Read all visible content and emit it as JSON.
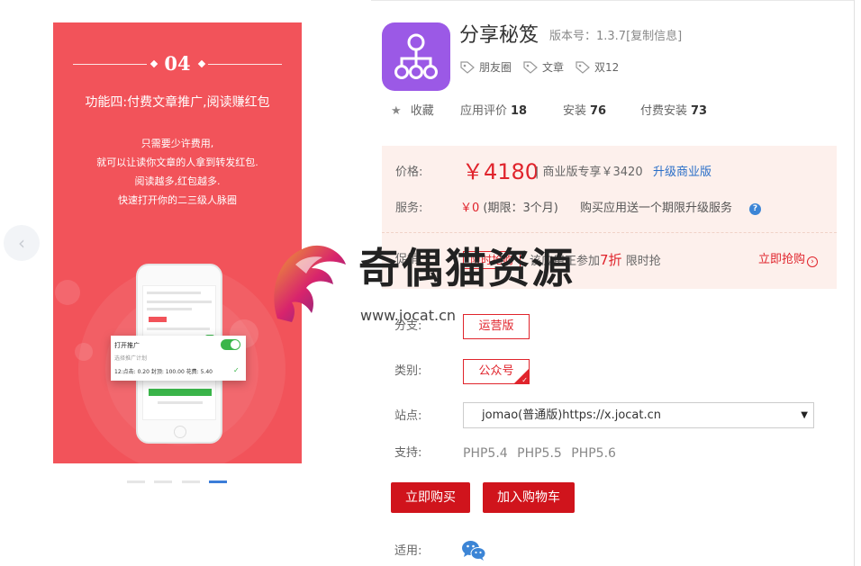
{
  "gallery": {
    "prev_icon": "chevron-left-icon",
    "slide": {
      "number": "04",
      "feature_title": "功能四:付费文章推广,阅读赚红包",
      "description_lines": [
        "只需要少许费用,",
        "就可以让读你文章的人拿到转发红包.",
        "阅读越多,红包越多.",
        "快速打开你的二三级人脉圈"
      ],
      "popup": {
        "title": "打开推广",
        "subtitle": "选择推广计划",
        "detail": "12:点击: 0.20 封顶: 100.00 花费: 5.40"
      }
    },
    "dots_active_index": 3
  },
  "app": {
    "icon_color": "#9b59e6",
    "name": "分享秘笈",
    "version_text": "版本号：1.3.7[复制信息]",
    "tags": [
      "朋友圈",
      "文章",
      "双12"
    ],
    "stats": {
      "favorite_label": "收藏",
      "rating_label": "应用评价",
      "rating_count": "18",
      "install_label": "安装",
      "install_count": "76",
      "paid_label": "付费安装",
      "paid_count": "73"
    }
  },
  "pricing": {
    "price_label": "价格:",
    "price": "￥4180",
    "business_note": "| 商业版专享￥3420",
    "upgrade_link": "升级商业版",
    "service_label": "服务:",
    "service_price": "￥0",
    "service_period": "(期限：3个月)",
    "service_desc": "购买应用送一个期限升级服务",
    "promo_label": "促销:",
    "promo_badge": "限时抢购",
    "promo_text_before": "该应用正参加",
    "promo_discount": "7折",
    "promo_text_after": "限时抢",
    "buy_now_link": "立即抢购"
  },
  "options": {
    "branch_label": "分支:",
    "branch_value": "运营版",
    "category_label": "类别:",
    "category_value": "公众号",
    "site_label": "站点:",
    "site_value": "jomao(普通版)https://x.jocat.cn",
    "support_label": "支持:",
    "support_values": "PHP5.4 PHP5.5 PHP5.6",
    "applies_label": "适用:"
  },
  "actions": {
    "buy_now": "立即购买",
    "add_to_cart": "加入购物车"
  },
  "watermark": {
    "text": "奇偶猫资源",
    "url": "www.jocat.cn"
  },
  "colors": {
    "accent_red": "#d0141c",
    "price_red": "#e0242c",
    "slide_bg": "#f2535a",
    "link_blue": "#2a6fc8",
    "price_box_bg": "#fdf0ec"
  }
}
